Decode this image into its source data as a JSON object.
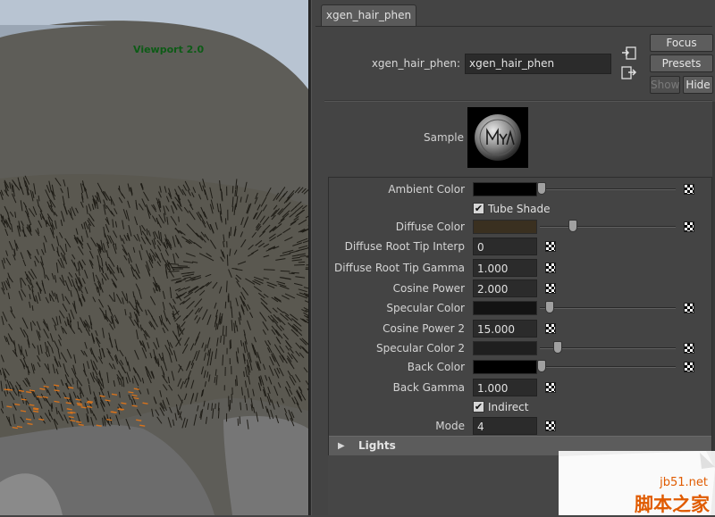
{
  "viewport": {
    "label": "Viewport 2.0"
  },
  "editor": {
    "tab_label": "xgen_hair_phen",
    "node_label": "xgen_hair_phen:",
    "node_value": "xgen_hair_phen",
    "buttons": {
      "focus": "Focus",
      "presets": "Presets",
      "show": "Show",
      "hide": "Hide"
    },
    "sample_label": "Sample",
    "attributes": [
      {
        "label": "Ambient Color",
        "kind": "color",
        "color": "#000000",
        "slider": 0.0
      },
      {
        "label": "Tube Shade",
        "kind": "checkbox",
        "checked": true
      },
      {
        "label": "Diffuse Color",
        "kind": "color",
        "color": "#3a3020",
        "slider": 0.23
      },
      {
        "label": "Diffuse Root Tip Interp",
        "kind": "number",
        "value": "0"
      },
      {
        "label": "Diffuse Root Tip Gamma",
        "kind": "number",
        "value": "1.000"
      },
      {
        "label": "Cosine Power",
        "kind": "number",
        "value": "2.000"
      },
      {
        "label": "Specular Color",
        "kind": "color",
        "color": "#131313",
        "slider": 0.06
      },
      {
        "label": "Cosine Power 2",
        "kind": "number",
        "value": "15.000"
      },
      {
        "label": "Specular Color 2",
        "kind": "color",
        "color": "#1f1f1f",
        "slider": 0.12
      },
      {
        "label": "Back Color",
        "kind": "color",
        "color": "#000000",
        "slider": 0.0
      },
      {
        "label": "Back Gamma",
        "kind": "number",
        "value": "1.000"
      },
      {
        "label": "Indirect",
        "kind": "checkbox",
        "checked": true
      },
      {
        "label": "Mode",
        "kind": "number",
        "value": "4"
      }
    ],
    "lights_section": "Lights"
  },
  "watermark": {
    "domain": "jb51.net",
    "text": "脚本之家"
  }
}
